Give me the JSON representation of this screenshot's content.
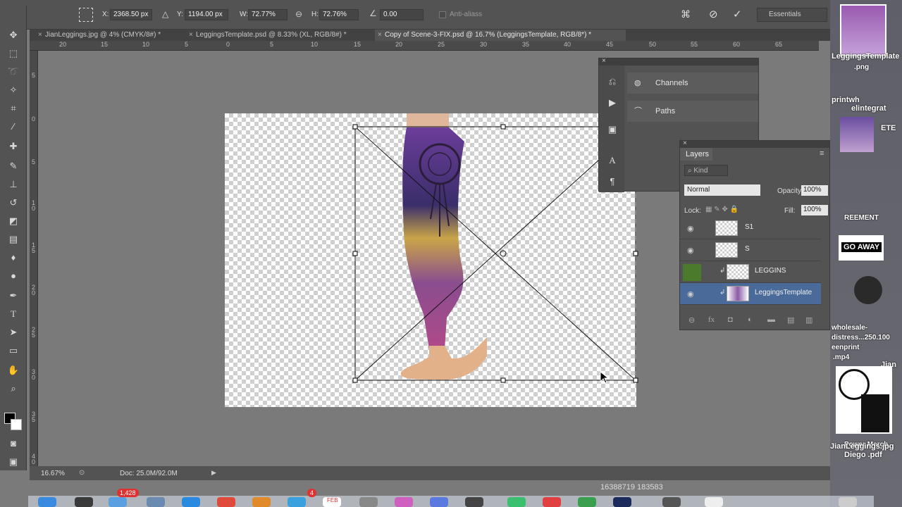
{
  "options_bar": {
    "x_label": "X:",
    "x_value": "2368.50 px",
    "y_label": "Y:",
    "y_value": "1194.00 px",
    "w_label": "W:",
    "w_value": "72.77%",
    "h_label": "H:",
    "h_value": "72.76%",
    "angle_value": "0.00",
    "antialias_label": "Anti-aliass",
    "workspace": "Essentials"
  },
  "tabs": [
    {
      "label": "JianLeggings.jpg @ 4% (CMYK/8#) *"
    },
    {
      "label": "LeggingsTemplate.psd @ 8.33% (XL, RGB/8#) *"
    },
    {
      "label": "Copy of Scene-3-FIX.psd @ 16.7% (LeggingsTemplate, RGB/8*) *"
    }
  ],
  "hruler_ticks": [
    "20",
    "15",
    "10",
    "5",
    "0",
    "5",
    "10",
    "15",
    "20",
    "25",
    "30",
    "35",
    "40",
    "45",
    "50",
    "55",
    "60",
    "65"
  ],
  "vruler_ticks": [
    "5",
    "0",
    "5",
    "1\n0",
    "1\n5",
    "2\n0",
    "2\n5",
    "3\n0",
    "3\n5",
    "4\n0"
  ],
  "channels_panel": {
    "channels_label": "Channels",
    "paths_label": "Paths"
  },
  "layers_panel": {
    "title": "Layers",
    "kind_label": "Kind",
    "blend_mode": "Normal",
    "opacity_label": "Opacity:",
    "opacity_value": "100%",
    "lock_label": "Lock:",
    "fill_label": "Fill:",
    "fill_value": "100%",
    "layers": [
      {
        "name": "S1"
      },
      {
        "name": "S"
      },
      {
        "name": "LEGGINS"
      },
      {
        "name": "LeggingsTemplate"
      }
    ]
  },
  "status": {
    "zoom": "16.67%",
    "doc": "Doc: 25.0M/92.0M"
  },
  "desktop": {
    "files": [
      "LeggingsTemplate",
      ".png",
      "printwh",
      "elintegrat",
      "ETE",
      "Jian",
      "Power Merch",
      "JianLeggings.jpg",
      "Diego .pdf",
      "GO AWAY",
      "eenprint",
      "wholesale-",
      "distress...250.100",
      ".mp4",
      "REEMENT",
      "1638"
    ],
    "coords": "16388719 183583"
  },
  "dock": {
    "badge_mail": "1,428",
    "badge_cal": "4",
    "cal_month": "FEB"
  },
  "colors": {
    "selection_bg": "#4a6a9a",
    "link_green": "#4a7a2a"
  }
}
